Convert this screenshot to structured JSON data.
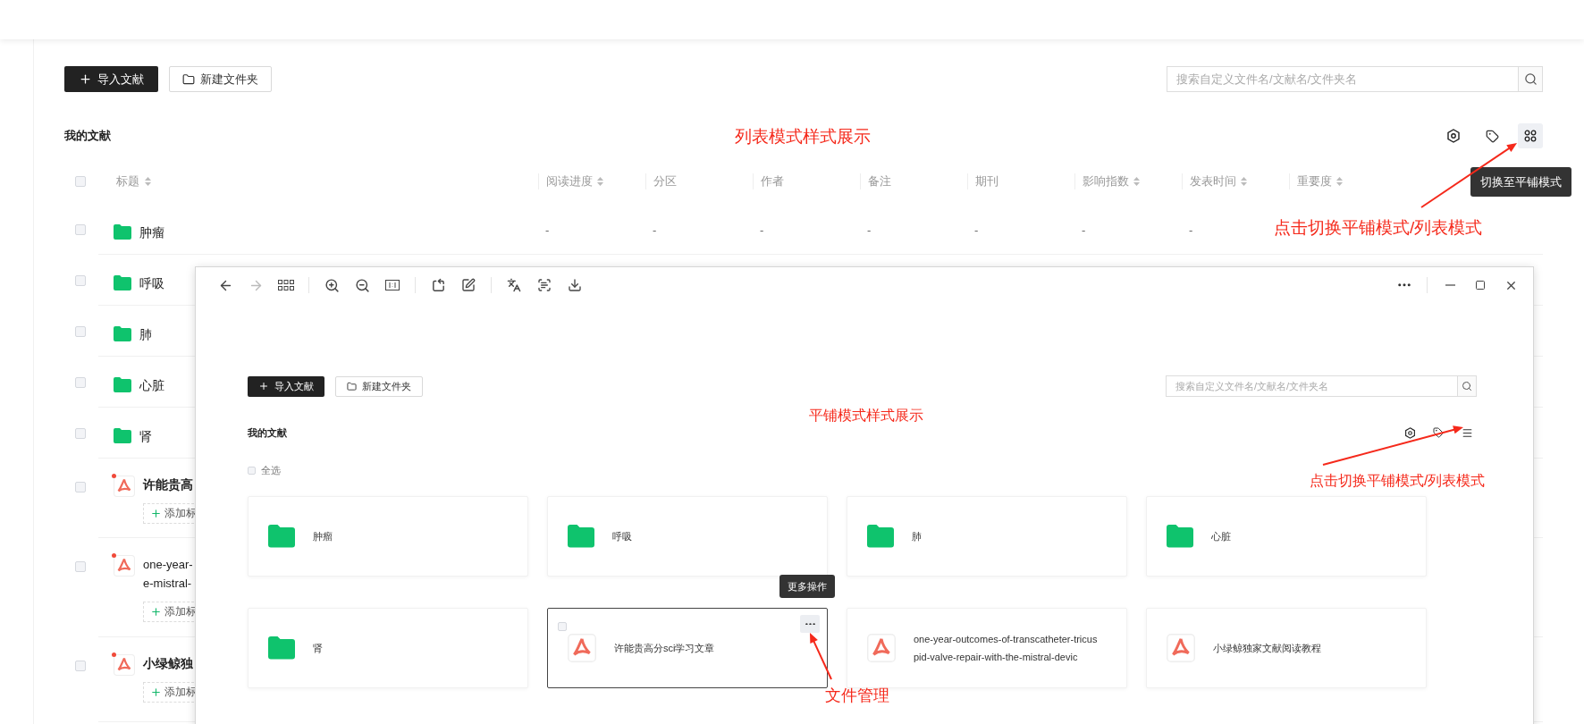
{
  "toolbar": {
    "import_button": "导入文献",
    "new_folder_button": "新建文件夹",
    "search": {
      "placeholder": "搜索自定义文件名/文献名/文件夹名"
    }
  },
  "section_title": "我的文献",
  "view_switch_tooltip": "切换至平铺模式",
  "table": {
    "select_all": {
      "checked": false
    },
    "columns": [
      {
        "label": "标题",
        "sortable": true
      },
      {
        "label": "阅读进度",
        "sortable": true
      },
      {
        "label": "分区"
      },
      {
        "label": "作者"
      },
      {
        "label": "备注"
      },
      {
        "label": "期刊"
      },
      {
        "label": "影响指数",
        "sortable": true
      },
      {
        "label": "发表时间",
        "sortable": true
      },
      {
        "label": "重要度",
        "sortable": true
      }
    ],
    "rows": [
      {
        "kind": "folder",
        "checked": false,
        "title_lines": [
          "肿瘤"
        ],
        "cells": [
          "-",
          "-",
          "-",
          "-",
          "-",
          "-",
          "-"
        ]
      },
      {
        "kind": "folder",
        "checked": false,
        "title_lines": [
          "呼吸"
        ]
      },
      {
        "kind": "folder",
        "checked": false,
        "title_lines": [
          "肺"
        ]
      },
      {
        "kind": "folder",
        "checked": false,
        "title_lines": [
          "心脏"
        ]
      },
      {
        "kind": "folder",
        "checked": false,
        "title_lines": [
          "肾"
        ]
      },
      {
        "kind": "pdf",
        "checked": false,
        "title_lines": [
          "许能贵高"
        ],
        "bold": true,
        "unread": true,
        "tag_button": "添加标"
      },
      {
        "kind": "pdf",
        "checked": false,
        "title_lines": [
          "one-year-",
          "e-mistral-"
        ],
        "bold": false,
        "unread": true,
        "tag_button": "添加标"
      },
      {
        "kind": "pdf",
        "checked": false,
        "title_lines": [
          "小绿鲸独"
        ],
        "bold": true,
        "unread": true,
        "tag_button": "添加标"
      }
    ]
  },
  "viewer": {
    "import_button": "导入文献",
    "new_folder_button": "新建文件夹",
    "search": {
      "placeholder": "搜索自定义文件名/文献名/文件夹名"
    },
    "section_title": "我的文献",
    "select_all": {
      "label": "全选",
      "checked": false
    },
    "cards": [
      {
        "kind": "folder",
        "title_lines": [
          "肿瘤"
        ],
        "selected": false
      },
      {
        "kind": "folder",
        "title_lines": [
          "呼吸"
        ],
        "selected": false
      },
      {
        "kind": "folder",
        "title_lines": [
          "肺"
        ],
        "selected": false
      },
      {
        "kind": "folder",
        "title_lines": [
          "心脏"
        ],
        "selected": false
      },
      {
        "kind": "folder",
        "title_lines": [
          "肾"
        ],
        "selected": false
      },
      {
        "kind": "pdf",
        "title_lines": [
          "许能贵高分sci学习文章"
        ],
        "selected": true
      },
      {
        "kind": "pdf",
        "title_lines": [
          "one-year-outcomes-of-transcatheter-tricus",
          "pid-valve-repair-with-the-mistral-devic"
        ],
        "selected": false
      },
      {
        "kind": "pdf",
        "title_lines": [
          "小绿鲸独家文献阅读教程"
        ],
        "selected": false
      }
    ],
    "more_tooltip": "更多操作"
  },
  "annotations": {
    "list_caption": "列表模式样式展示",
    "list_hint": "点击切换平铺模式/列表模式",
    "tile_caption": "平铺模式样式展示",
    "tile_hint": "点击切换平铺模式/列表模式",
    "file_hint": "文件管理"
  }
}
